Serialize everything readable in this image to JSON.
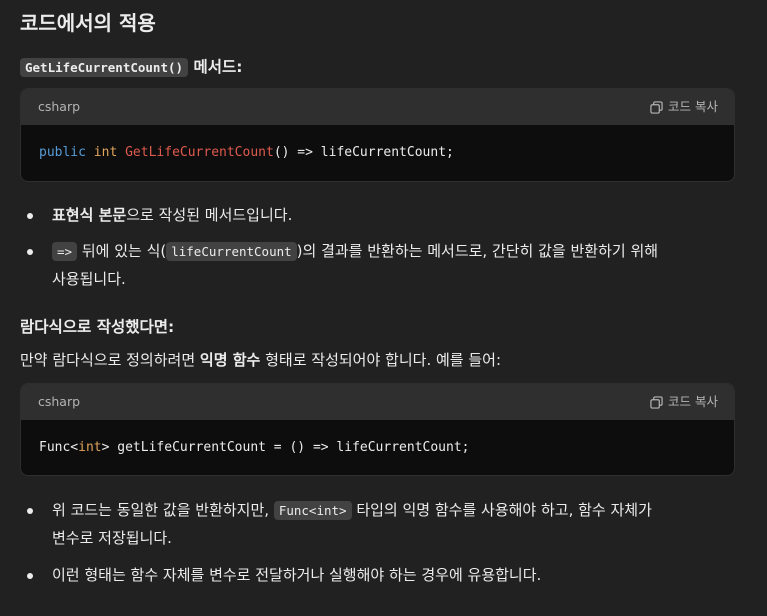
{
  "section_title": "코드에서의 적용",
  "method_heading": {
    "code": "GetLifeCurrentCount()",
    "suffix": "메서드:"
  },
  "code_block_1": {
    "language": "csharp",
    "copy_label": "코드 복사",
    "tokens": {
      "t1": "public",
      "t2": " ",
      "t3": "int",
      "t4": " ",
      "t5": "GetLifeCurrentCount",
      "t6": "() => lifeCurrentCount;"
    }
  },
  "bullets_1": [
    {
      "bold": "표현식 본문",
      "text": "으로 작성된 메서드입니다."
    },
    {
      "code_a": "=>",
      "text_a": " 뒤에 있는 식(",
      "code_b": "lifeCurrentCount",
      "text_b": ")의 결과를 반환하는 메서드로, 간단히 값을 반환하기 위해",
      "text_c": "사용됩니다."
    }
  ],
  "lambda_heading": "람다식으로 작성했다면:",
  "lambda_para": {
    "text_a": "만약 람다식으로 정의하려면 ",
    "bold": "익명 함수",
    "text_b": " 형태로 작성되어야 합니다. 예를 들어:"
  },
  "code_block_2": {
    "language": "csharp",
    "copy_label": "코드 복사",
    "tokens": {
      "t1": "Func<",
      "t2": "int",
      "t3": "> getLifeCurrentCount = () => lifeCurrentCount;"
    }
  },
  "bullets_2": [
    {
      "text_a": "위 코드는 동일한 값을 반환하지만, ",
      "code": "Func<int>",
      "text_b": " 타입의 익명 함수를 사용해야 하고, 함수 자체가",
      "text_c": "변수로 저장됩니다."
    },
    {
      "text": "이런 형태는 함수 자체를 변수로 전달하거나 실행해야 하는 경우에 유용합니다."
    }
  ],
  "colors": {
    "background": "#212121",
    "code_bg": "#0d0d0d",
    "code_header": "#2f2f2f",
    "keyword": "#569cd6",
    "type": "#e0a35c",
    "function": "#e05a4f"
  }
}
